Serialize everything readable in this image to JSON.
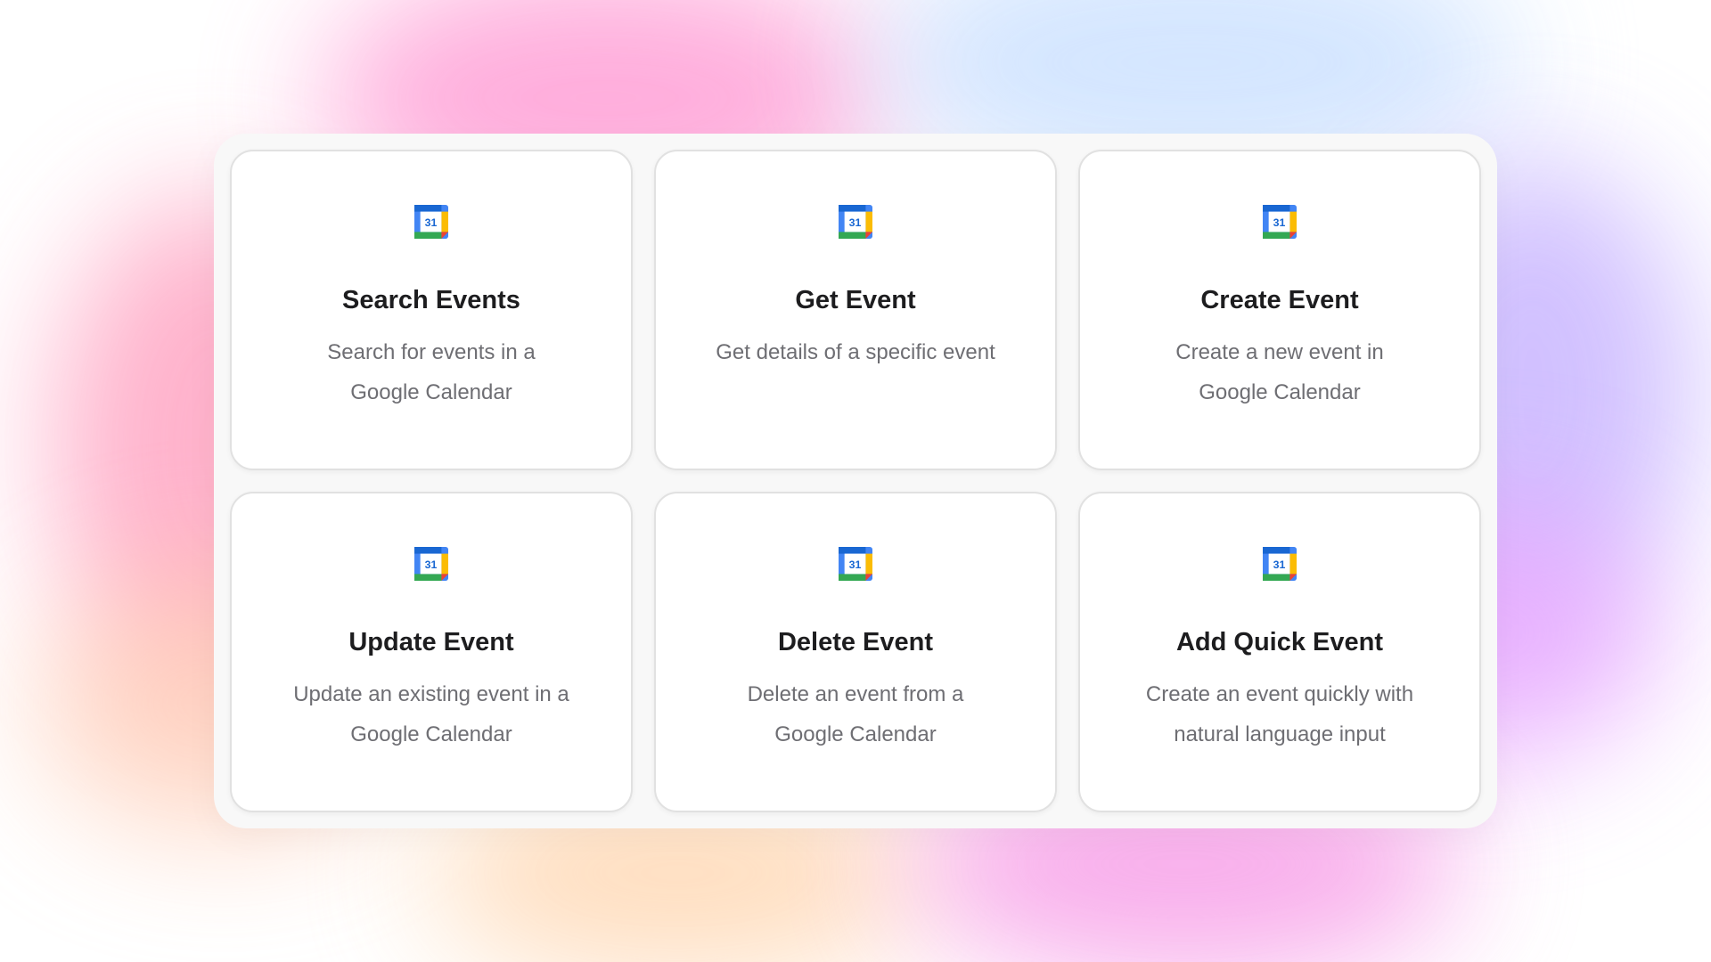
{
  "colors": {
    "gcal_blue": "#4285F4",
    "gcal_dark_blue": "#1967D2",
    "gcal_green": "#34A853",
    "gcal_yellow": "#FBBC04",
    "gcal_red": "#EA4335",
    "title_text": "#1d1d1f",
    "desc_text": "#6e6e73"
  },
  "icon": {
    "name": "google-calendar-icon",
    "day": "31"
  },
  "cards": [
    {
      "title": "Search Events",
      "desc_line1": "Search for events in a",
      "desc_line2": "Google Calendar"
    },
    {
      "title": "Get Event",
      "desc_line1": "Get details of a specific event",
      "desc_line2": ""
    },
    {
      "title": "Create Event",
      "desc_line1": "Create a new event in",
      "desc_line2": "Google Calendar"
    },
    {
      "title": "Update Event",
      "desc_line1": "Update an existing event in a",
      "desc_line2": "Google Calendar"
    },
    {
      "title": "Delete Event",
      "desc_line1": "Delete an event from a",
      "desc_line2": "Google Calendar"
    },
    {
      "title": "Add Quick Event",
      "desc_line1": "Create an event quickly with",
      "desc_line2": "natural language input"
    }
  ]
}
